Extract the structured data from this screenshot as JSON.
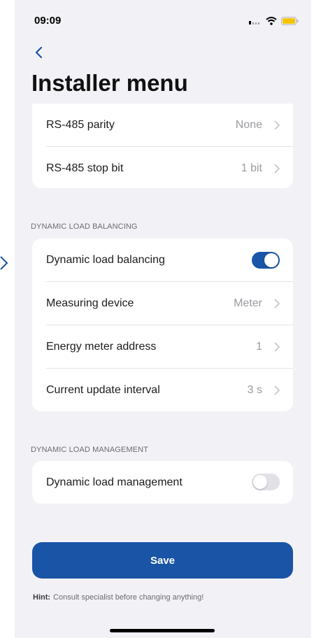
{
  "status_bar": {
    "time": "09:09",
    "icons": [
      "cellular-signal-icon",
      "wifi-icon",
      "battery-icon"
    ],
    "battery_color": "#f5c400"
  },
  "nav": {
    "back_icon": "chevron-left-icon",
    "title": "Installer menu"
  },
  "colors": {
    "accent": "#1a54a6",
    "background": "#f2f2f6",
    "toggle_off": "#e1e1e6"
  },
  "rs485_group": {
    "rows": [
      {
        "label": "RS-485 parity",
        "value": "None"
      },
      {
        "label": "RS-485 stop bit",
        "value": "1 bit"
      }
    ]
  },
  "dynamic_load_balancing": {
    "header": "DYNAMIC LOAD BALANCING",
    "toggle_label": "Dynamic load balancing",
    "toggle_on": true,
    "rows": [
      {
        "label": "Measuring device",
        "value": "Meter"
      },
      {
        "label": "Energy meter address",
        "value": "1"
      },
      {
        "label": "Current update interval",
        "value": "3 s"
      }
    ]
  },
  "dynamic_load_management": {
    "header": "DYNAMIC LOAD MANAGEMENT",
    "toggle_label": "Dynamic load management",
    "toggle_on": false
  },
  "save_label": "Save",
  "hint": {
    "prefix": "Hint:",
    "text": "Consult specialist before changing anything!"
  }
}
